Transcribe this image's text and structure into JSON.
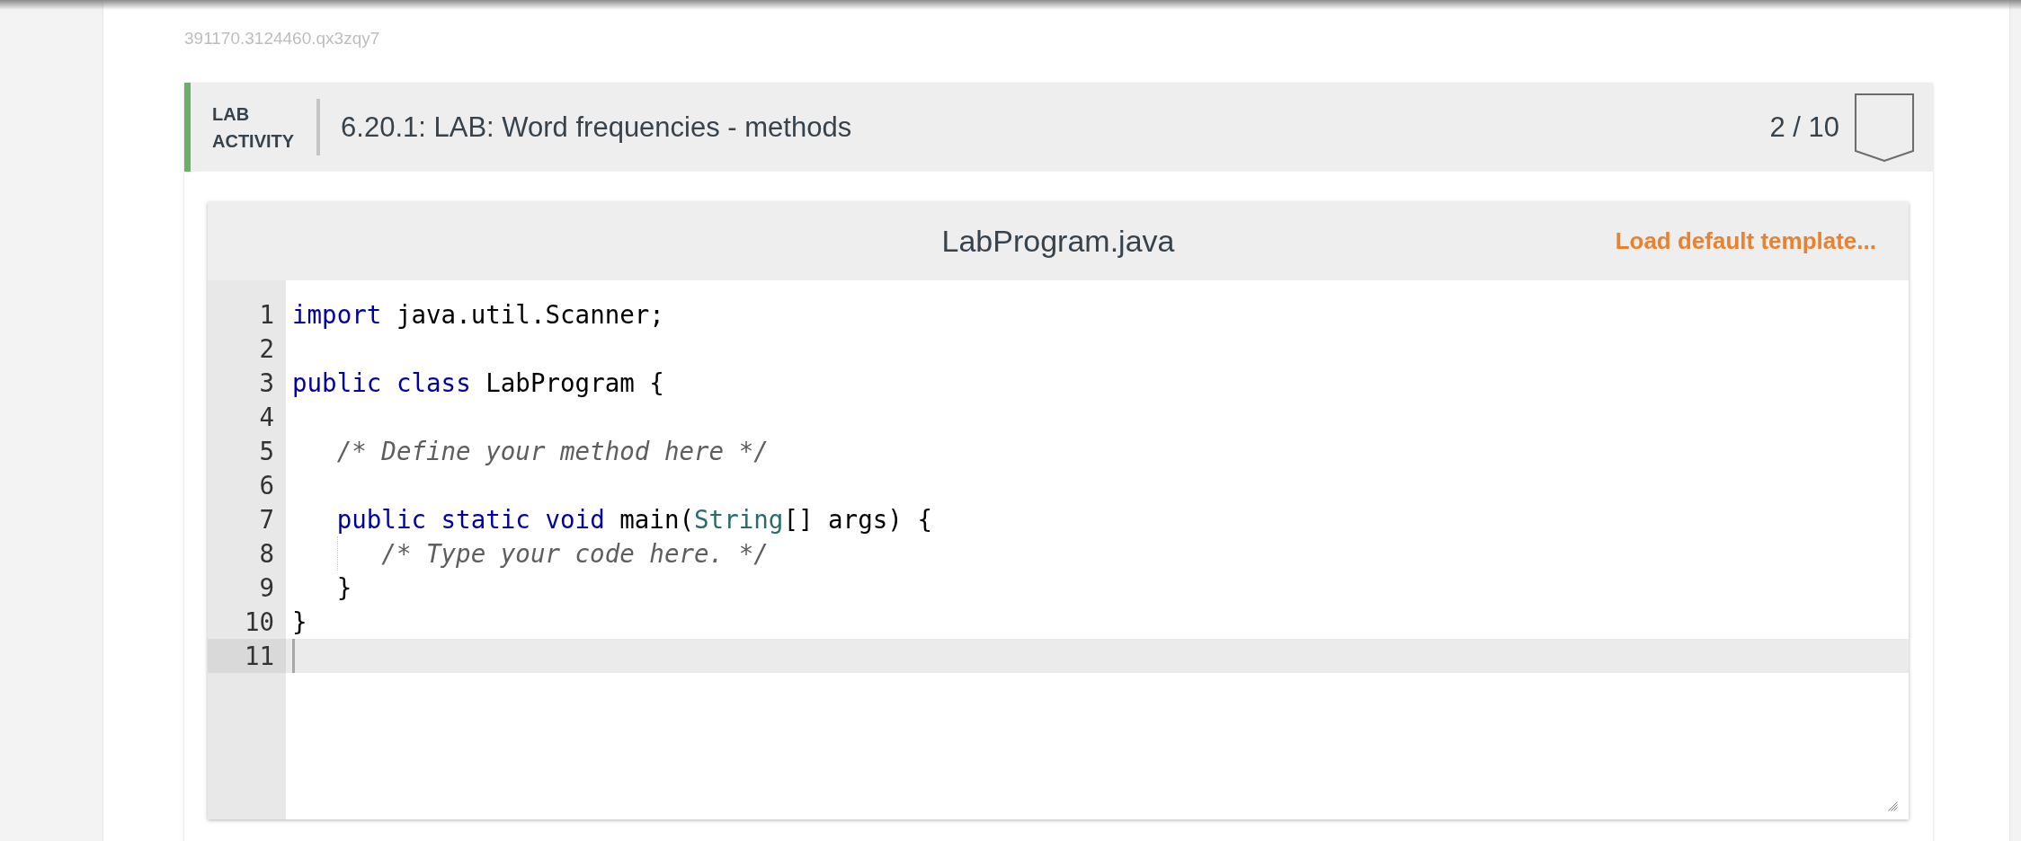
{
  "id_text": "391170.3124460.qx3zqy7",
  "activity": {
    "type_label": "LAB ACTIVITY",
    "title": "6.20.1: LAB: Word frequencies - methods",
    "score": "2 / 10",
    "completed": false
  },
  "editor": {
    "filename": "LabProgram.java",
    "template_button": "Load default template...",
    "lines": [
      {
        "number": "1",
        "active": false,
        "tokens": [
          {
            "text": "import",
            "kind": "keyword"
          },
          {
            "text": " java.util.Scanner;",
            "kind": "plain"
          }
        ]
      },
      {
        "number": "2",
        "active": false
      },
      {
        "number": "3",
        "active": false,
        "tokens": [
          {
            "text": "public",
            "kind": "keyword"
          },
          {
            "text": " class",
            "kind": "keyword"
          },
          {
            "text": " LabProgram {",
            "kind": "plain"
          }
        ],
        "children": [
          {
            "number": "4",
            "active": false
          },
          {
            "number": "5",
            "active": false,
            "tokens": [
              {
                "text": "/* Define your method here */",
                "kind": "comment"
              }
            ]
          },
          {
            "number": "6",
            "active": false
          },
          {
            "number": "7",
            "active": false,
            "tokens": [
              {
                "text": "public",
                "kind": "keyword"
              },
              {
                "text": " static",
                "kind": "keyword"
              },
              {
                "text": " void",
                "kind": "keyword"
              },
              {
                "text": " main(",
                "kind": "plain"
              },
              {
                "text": "String",
                "kind": "type"
              },
              {
                "text": "[] args) {",
                "kind": "plain"
              }
            ],
            "children": [
              {
                "number": "8",
                "active": false,
                "tokens": [
                  {
                    "text": "/* Type your code here. */",
                    "kind": "comment"
                  }
                ]
              }
            ]
          },
          {
            "number": "9",
            "active": false,
            "tokens": [
              {
                "text": "}",
                "kind": "plain"
              }
            ]
          }
        ]
      },
      {
        "number": "10",
        "active": false,
        "tokens": [
          {
            "text": "}",
            "kind": "plain"
          }
        ]
      },
      {
        "number": "11",
        "active": true
      }
    ]
  }
}
